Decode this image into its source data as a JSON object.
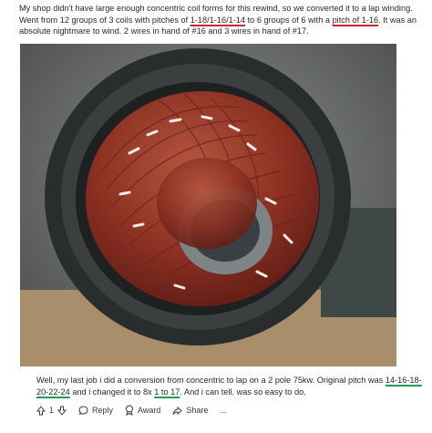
{
  "post": {
    "segments": [
      {
        "text": "My shop didn't have large enough concentric coil forms for this rewind, so we converted it to a lap winding. Went from 12 groups of 3 coils with pitches of ",
        "mark": false
      },
      {
        "text": "1-18/1-16/1-14",
        "mark": true
      },
      {
        "text": " to 6 groups of 6 with a ",
        "mark": false
      },
      {
        "text": "pitch of 1-16",
        "mark": true
      },
      {
        "text": ". It was an absolute nightmare to wind. 2 wires in hand of #16 and 3 wires in hand of #17.",
        "mark": false
      }
    ]
  },
  "reply": {
    "segments": [
      {
        "text": "Well, my last job i did a conversion from concentric to lap on a 2 pole 75kw. Original pitch was ",
        "mark": false
      },
      {
        "text": "14-16-18-20-22-24",
        "mark": true
      },
      {
        "text": " and i changed it to 8x ",
        "mark": false
      },
      {
        "text": "1 to 17",
        "mark": true
      },
      {
        "text": ". And i can tell. was so easy to do.",
        "mark": false
      }
    ]
  },
  "actions": {
    "vote_count": "1",
    "reply_label": "Reply",
    "award_label": "Award",
    "share_label": "Share",
    "more_label": "..."
  },
  "colors": {
    "highlight_post": "#d0262f",
    "highlight_reply": "#1e9e5a"
  },
  "icons": {
    "upvote": "arrow-up-icon",
    "downvote": "arrow-down-icon",
    "reply": "speech-bubble-icon",
    "award": "award-icon",
    "share": "share-arrow-icon",
    "more": "ellipsis-icon"
  }
}
